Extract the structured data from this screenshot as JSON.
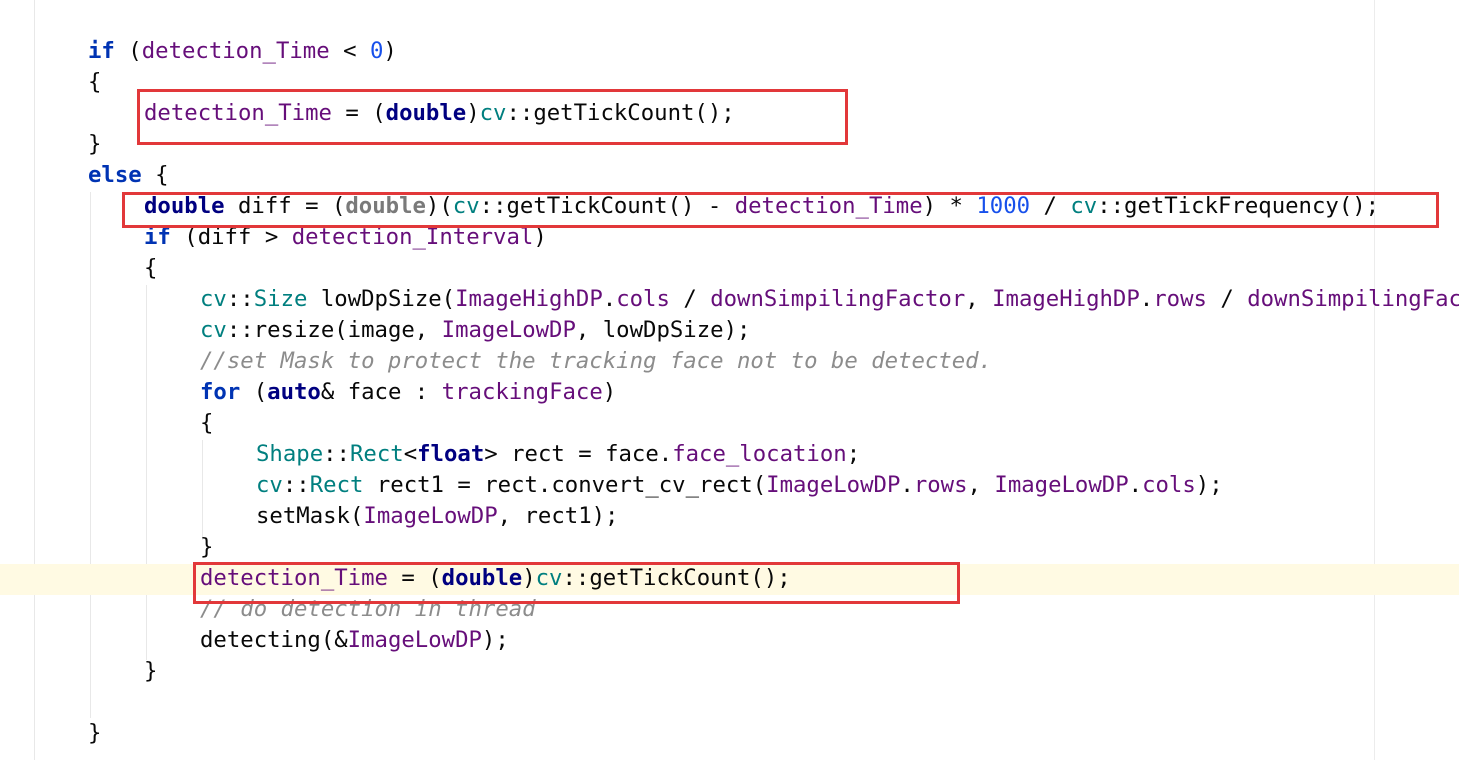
{
  "editor": {
    "language": "C++",
    "lines": [
      {
        "id": "l1",
        "indent": 1,
        "parts": [
          [
            "kw",
            "if"
          ],
          [
            "p",
            " ("
          ],
          [
            "var",
            "detection_Time"
          ],
          [
            "p",
            " < "
          ],
          [
            "num",
            "0"
          ],
          [
            "p",
            ")"
          ]
        ]
      },
      {
        "id": "l2",
        "indent": 1,
        "parts": [
          [
            "p",
            "{"
          ]
        ]
      },
      {
        "id": "l3",
        "indent": 2,
        "parts": [
          [
            "var",
            "detection_Time"
          ],
          [
            "p",
            " = ("
          ],
          [
            "kwb",
            "double"
          ],
          [
            "p",
            ")"
          ],
          [
            "ns",
            "cv"
          ],
          [
            "p",
            "::getTickCount();"
          ]
        ]
      },
      {
        "id": "l4",
        "indent": 1,
        "parts": [
          [
            "p",
            "}"
          ]
        ]
      },
      {
        "id": "l5",
        "indent": 1,
        "parts": [
          [
            "kw",
            "else"
          ],
          [
            "p",
            " {"
          ]
        ]
      },
      {
        "id": "l6",
        "indent": 2,
        "parts": [
          [
            "kwb",
            "double"
          ],
          [
            "p",
            " diff = ("
          ],
          [
            "kwg",
            "double"
          ],
          [
            "p",
            ")("
          ],
          [
            "ns",
            "cv"
          ],
          [
            "p",
            "::getTickCount() - "
          ],
          [
            "var",
            "detection_Time"
          ],
          [
            "p",
            ") * "
          ],
          [
            "num",
            "1000"
          ],
          [
            "p",
            " / "
          ],
          [
            "ns",
            "cv"
          ],
          [
            "p",
            "::getTickFrequency();"
          ]
        ]
      },
      {
        "id": "l7",
        "indent": 2,
        "parts": [
          [
            "kw",
            "if"
          ],
          [
            "p",
            " (diff > "
          ],
          [
            "var",
            "detection_Interval"
          ],
          [
            "p",
            ")"
          ]
        ]
      },
      {
        "id": "l8",
        "indent": 2,
        "parts": [
          [
            "p",
            "{"
          ]
        ]
      },
      {
        "id": "l9",
        "indent": 3,
        "parts": [
          [
            "ns",
            "cv"
          ],
          [
            "p",
            "::"
          ],
          [
            "ns",
            "Size"
          ],
          [
            "p",
            " lowDpSize("
          ],
          [
            "var",
            "ImageHighDP"
          ],
          [
            "p",
            "."
          ],
          [
            "var",
            "cols"
          ],
          [
            "p",
            " / "
          ],
          [
            "var",
            "downSimpilingFactor"
          ],
          [
            "p",
            ", "
          ],
          [
            "var",
            "ImageHighDP"
          ],
          [
            "p",
            "."
          ],
          [
            "var",
            "rows"
          ],
          [
            "p",
            " / "
          ],
          [
            "var",
            "downSimpilingFactor"
          ],
          [
            "p",
            ");"
          ]
        ]
      },
      {
        "id": "l10",
        "indent": 3,
        "parts": [
          [
            "ns",
            "cv"
          ],
          [
            "p",
            "::resize(image, "
          ],
          [
            "var",
            "ImageLowDP"
          ],
          [
            "p",
            ", lowDpSize);"
          ]
        ]
      },
      {
        "id": "l11",
        "indent": 3,
        "parts": [
          [
            "cmt",
            "//set Mask to protect the tracking face not to be detected."
          ]
        ]
      },
      {
        "id": "l12",
        "indent": 3,
        "parts": [
          [
            "kw",
            "for"
          ],
          [
            "p",
            " ("
          ],
          [
            "kwb",
            "auto"
          ],
          [
            "p",
            "& face : "
          ],
          [
            "var",
            "trackingFace"
          ],
          [
            "p",
            ")"
          ]
        ]
      },
      {
        "id": "l13",
        "indent": 3,
        "parts": [
          [
            "p",
            "{"
          ]
        ]
      },
      {
        "id": "l14",
        "indent": 4,
        "parts": [
          [
            "ns",
            "Shape"
          ],
          [
            "p",
            "::"
          ],
          [
            "ns",
            "Rect"
          ],
          [
            "p",
            "<"
          ],
          [
            "kwb",
            "float"
          ],
          [
            "p",
            "> rect = face."
          ],
          [
            "var",
            "face_location"
          ],
          [
            "p",
            ";"
          ]
        ]
      },
      {
        "id": "l15",
        "indent": 4,
        "parts": [
          [
            "ns",
            "cv"
          ],
          [
            "p",
            "::"
          ],
          [
            "ns",
            "Rect"
          ],
          [
            "p",
            " rect1 = rect.convert_cv_rect("
          ],
          [
            "var",
            "ImageLowDP"
          ],
          [
            "p",
            "."
          ],
          [
            "var",
            "rows"
          ],
          [
            "p",
            ", "
          ],
          [
            "var",
            "ImageLowDP"
          ],
          [
            "p",
            "."
          ],
          [
            "var",
            "cols"
          ],
          [
            "p",
            ");"
          ]
        ]
      },
      {
        "id": "l16",
        "indent": 4,
        "parts": [
          [
            "p",
            "setMask("
          ],
          [
            "var",
            "ImageLowDP"
          ],
          [
            "p",
            ", rect1);"
          ]
        ]
      },
      {
        "id": "l17",
        "indent": 3,
        "parts": [
          [
            "p",
            "}"
          ]
        ]
      },
      {
        "id": "l18",
        "indent": 3,
        "parts": [
          [
            "var",
            "detection_Time"
          ],
          [
            "p",
            " = ("
          ],
          [
            "kwb",
            "double"
          ],
          [
            "p",
            ")"
          ],
          [
            "ns",
            "cv"
          ],
          [
            "p",
            "::getTickCount();"
          ]
        ]
      },
      {
        "id": "l19",
        "indent": 3,
        "parts": [
          [
            "cmt",
            "// do detection in thread"
          ]
        ]
      },
      {
        "id": "l20",
        "indent": 3,
        "parts": [
          [
            "p",
            "detecting(&"
          ],
          [
            "var",
            "ImageLowDP"
          ],
          [
            "p",
            ");"
          ]
        ]
      },
      {
        "id": "l21",
        "indent": 2,
        "parts": [
          [
            "p",
            "}"
          ]
        ]
      },
      {
        "id": "l22",
        "indent": 1,
        "parts": []
      },
      {
        "id": "l23",
        "indent": 1,
        "parts": [
          [
            "p",
            "}"
          ]
        ]
      }
    ],
    "current_line": "l18",
    "highlighted_lines": [
      "l3",
      "l6",
      "l18"
    ],
    "colors": {
      "keyword": "#0033b3",
      "member": "#660e7a",
      "namespace": "#007f7f",
      "number": "#1750eb",
      "comment": "#8c8c8c",
      "highlight_box": "#e2383a",
      "current_line_bg": "#fffae3"
    }
  }
}
